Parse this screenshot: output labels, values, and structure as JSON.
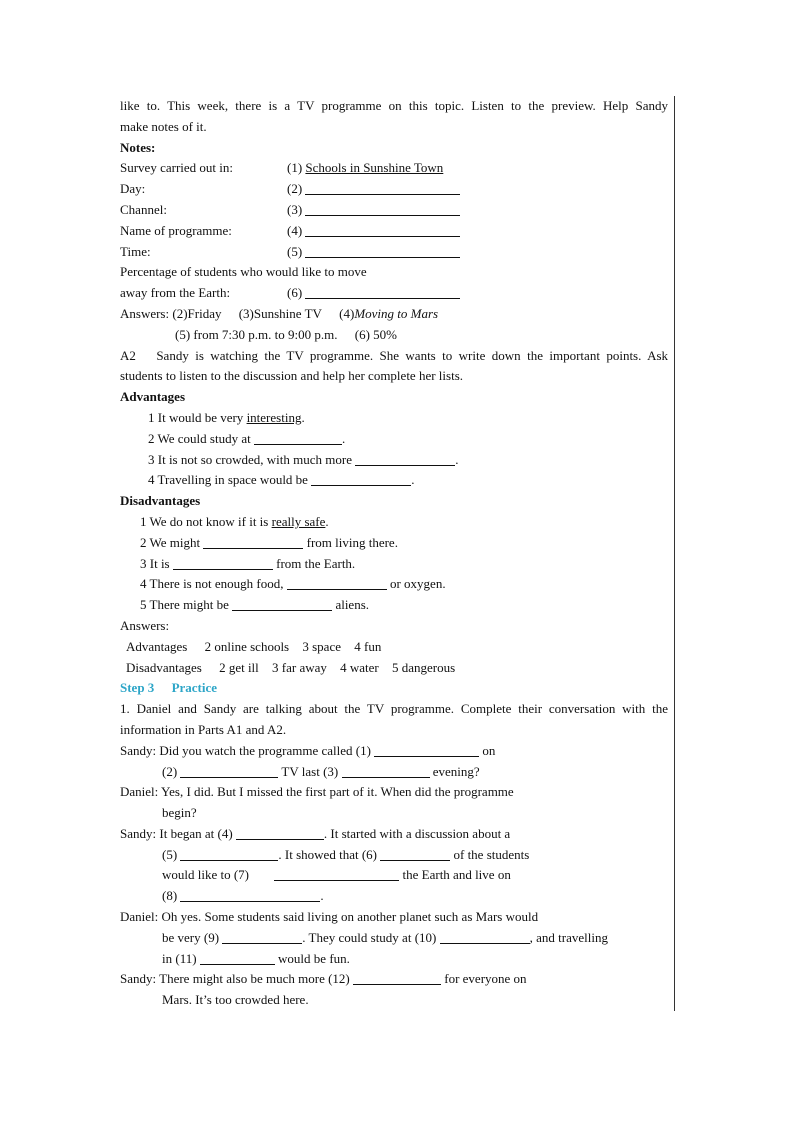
{
  "intro": {
    "line1": "like to. This week, there is a TV programme on this topic. Listen to the preview. Help Sandy",
    "line2": "make notes of it."
  },
  "notes": {
    "heading": "Notes:",
    "rows": [
      {
        "label": "Survey carried out in:",
        "num": "(1)",
        "answer": "Schools in Sunshine Town"
      },
      {
        "label": "Day:",
        "num": "(2)"
      },
      {
        "label": "Channel:",
        "num": "(3)"
      },
      {
        "label": "Name of programme:",
        "num": "(4)"
      },
      {
        "label": "Time:",
        "num": "(5)"
      }
    ],
    "percentage_label_1": "Percentage of students who would like to move",
    "percentage_label_2": "away from the Earth:",
    "percentage_num": "(6)",
    "answers_prefix": "Answers:",
    "answers_line1": [
      "(2)Friday",
      "(3)Sunshine TV",
      "(4)"
    ],
    "answers_line1_italic": "Moving to Mars",
    "answers_line2": [
      "(5) from 7:30 p.m. to 9:00 p.m.",
      "(6) 50%"
    ]
  },
  "a2": {
    "label": "A2",
    "line1": "Sandy is watching the TV programme. She wants to write down the important points. Ask",
    "line2": "students to listen to the discussion and help her complete her lists."
  },
  "advantages": {
    "heading": "Advantages",
    "items": [
      {
        "pre": "1 It would be very ",
        "answer": "interesting",
        "post": "."
      },
      {
        "pre": "2 We could study at ",
        "post": "."
      },
      {
        "pre": "3 It is not so crowded, with much more ",
        "post": "."
      },
      {
        "pre": "4 Travelling in space would be ",
        "post": "."
      }
    ]
  },
  "disadvantages": {
    "heading": "Disadvantages",
    "items": [
      {
        "pre": "1 We do not know if it is ",
        "answer": "really safe",
        "post": "."
      },
      {
        "pre": "2 We might ",
        "post": " from living there."
      },
      {
        "pre": "3 It is ",
        "post": " from the Earth."
      },
      {
        "pre": "4 There is not enough food, ",
        "post": " or oxygen."
      },
      {
        "pre": "5 There might be ",
        "post": " aliens."
      }
    ]
  },
  "answers2": {
    "heading": "Answers:",
    "adv_label": "Advantages",
    "adv": [
      "2 online schools",
      "3 space",
      "4 fun"
    ],
    "dis_label": "Disadvantages",
    "dis": [
      "2 get ill",
      "3 far away",
      "4 water",
      "5 dangerous"
    ]
  },
  "step3": {
    "heading_step": "Step 3",
    "heading_title": "Practice",
    "instruction_1": "1. Daniel and Sandy are talking about the TV programme. Complete their conversation with the",
    "instruction_2": "information in Parts A1 and A2."
  },
  "dialogue": {
    "sandy": "Sandy:",
    "daniel": "Daniel:",
    "s1_a": "Did you watch the programme called (1) ",
    "s1_b": " on",
    "s1_c": "(2) ",
    "s1_d": " TV last (3) ",
    "s1_e": " evening?",
    "d1_a": "Yes, I did. But I missed the first part of it. When did the programme",
    "d1_b": "begin?",
    "s2_a": "It began at (4) ",
    "s2_b": ". It started with a discussion about a",
    "s2_c": "(5) ",
    "s2_d": ". It showed that (6) ",
    "s2_e": " of the students",
    "s2_f": "would like to (7) ",
    "s2_g": " the Earth and live on",
    "s2_h": "(8) ",
    "s2_i": ".",
    "d2_a": "Oh yes. Some students said living on another planet such as Mars would",
    "d2_b": "be very (9) ",
    "d2_c": ". They could study at (10) ",
    "d2_d": ", and travelling",
    "d2_e": "in (11) ",
    "d2_f": " would be fun.",
    "s3_a": "There might also be much more (12) ",
    "s3_b": " for everyone on",
    "s3_c": "Mars. It’s too crowded here."
  }
}
